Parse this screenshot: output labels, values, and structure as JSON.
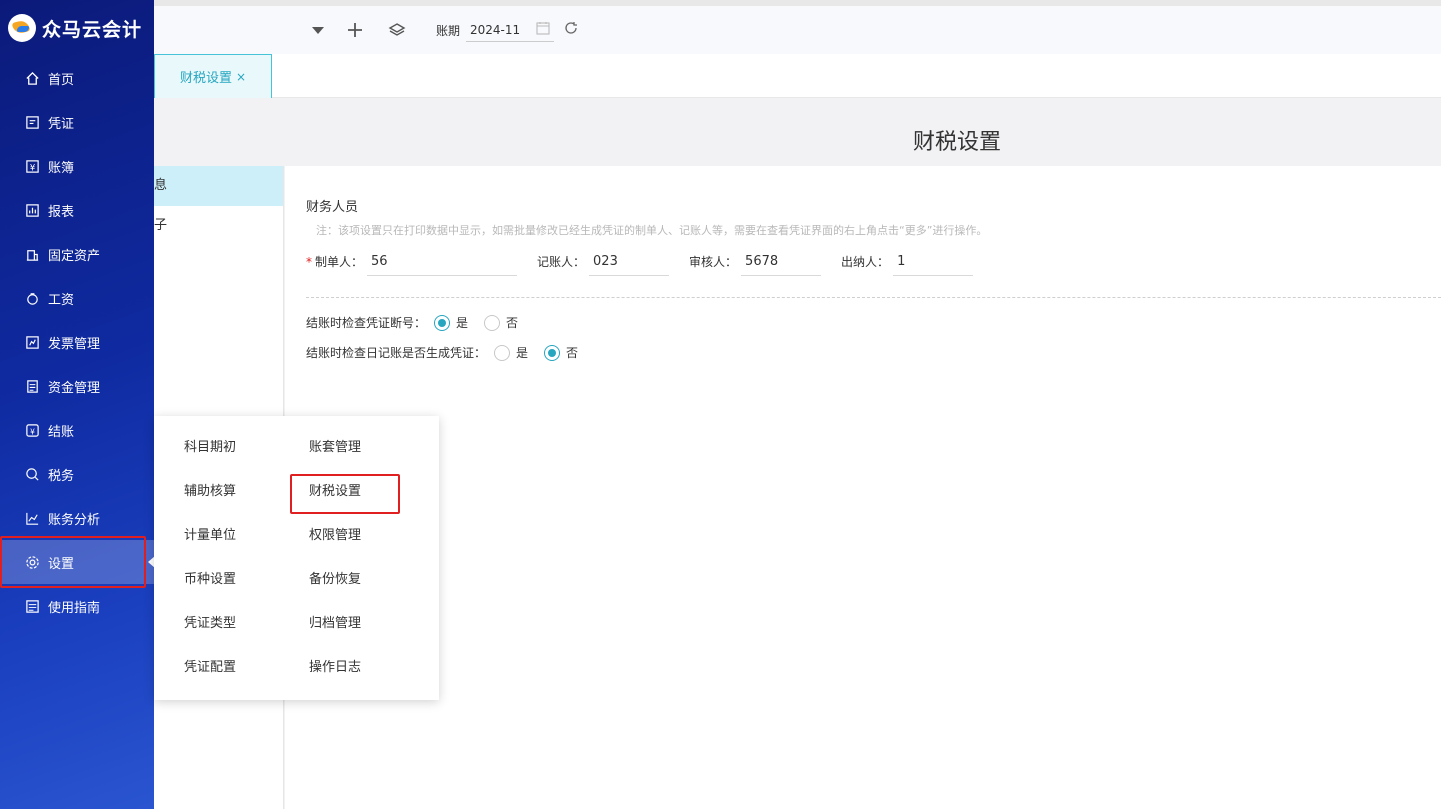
{
  "app": {
    "name": "众马云会计"
  },
  "sidebar": {
    "items": [
      {
        "label": "首页",
        "icon": "home-icon"
      },
      {
        "label": "凭证",
        "icon": "voucher-icon"
      },
      {
        "label": "账簿",
        "icon": "ledger-icon"
      },
      {
        "label": "报表",
        "icon": "report-icon"
      },
      {
        "label": "固定资产",
        "icon": "asset-icon"
      },
      {
        "label": "工资",
        "icon": "salary-icon"
      },
      {
        "label": "发票管理",
        "icon": "invoice-icon"
      },
      {
        "label": "资金管理",
        "icon": "fund-icon"
      },
      {
        "label": "结账",
        "icon": "closing-icon"
      },
      {
        "label": "税务",
        "icon": "tax-icon"
      },
      {
        "label": "账务分析",
        "icon": "analysis-icon"
      },
      {
        "label": "设置",
        "icon": "gear-icon",
        "active": true
      },
      {
        "label": "使用指南",
        "icon": "guide-icon"
      }
    ]
  },
  "toolbar": {
    "period_label": "账期",
    "period_value": "2024-11"
  },
  "tabs": [
    {
      "label": "财税设置",
      "close": "×"
    }
  ],
  "page": {
    "title": "财税设置",
    "left_items": [
      "息",
      "子"
    ]
  },
  "finance_people": {
    "title": "财务人员",
    "note": "注：该项设置只在打印数据中显示，如需批量修改已经生成凭证的制单人、记账人等，需要在查看凭证界面的右上角点击“更多”进行操作。",
    "fields": [
      {
        "label": "制单人：",
        "value": "56",
        "required": "*"
      },
      {
        "label": "记账人：",
        "value": "023"
      },
      {
        "label": "审核人：",
        "value": "5678"
      },
      {
        "label": "出纳人：",
        "value": "1"
      }
    ]
  },
  "options": [
    {
      "label": "结账时检查凭证断号：",
      "yes": "是",
      "no": "否",
      "selected": "yes"
    },
    {
      "label": "结账时检查日记账是否生成凭证：",
      "yes": "是",
      "no": "否",
      "selected": "no"
    }
  ],
  "settings_menu": {
    "col1": [
      "科目期初",
      "辅助核算",
      "计量单位",
      "币种设置",
      "凭证类型",
      "凭证配置"
    ],
    "col2": [
      "账套管理",
      "财税设置",
      "权限管理",
      "备份恢复",
      "归档管理",
      "操作日志"
    ]
  },
  "colors": {
    "accent": "#27a6c0",
    "highlight": "#e02020",
    "sidebar": "#0f2aa0"
  }
}
